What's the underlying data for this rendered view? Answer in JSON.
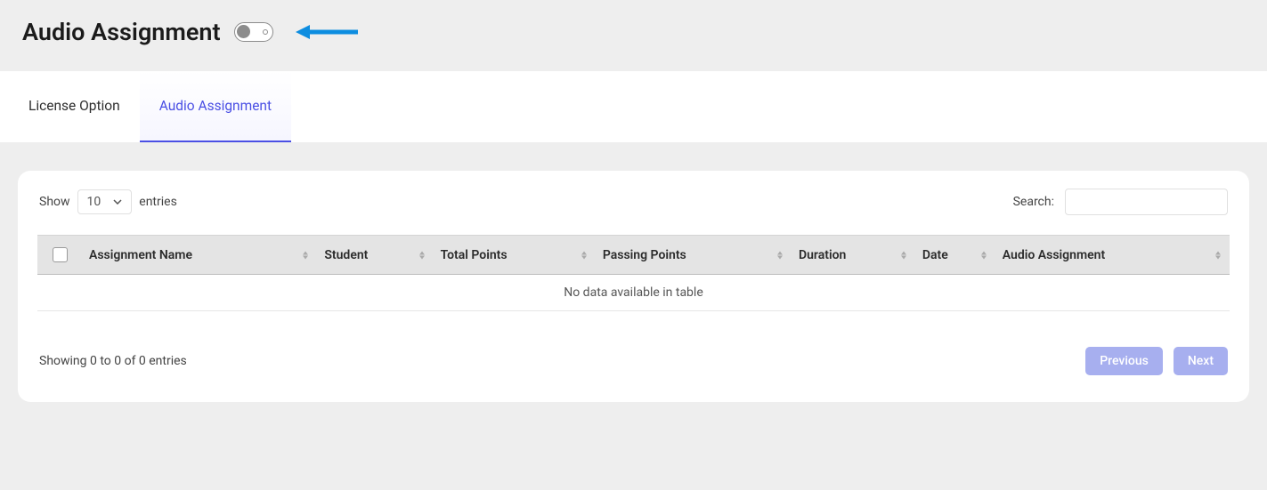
{
  "header": {
    "title": "Audio Assignment"
  },
  "tabs": [
    {
      "label": "License Option",
      "active": false
    },
    {
      "label": "Audio Assignment",
      "active": true
    }
  ],
  "controls": {
    "show_label": "Show",
    "entries_value": "10",
    "entries_label": "entries",
    "search_label": "Search:",
    "search_value": ""
  },
  "table": {
    "columns": [
      "Assignment Name",
      "Student",
      "Total Points",
      "Passing Points",
      "Duration",
      "Date",
      "Audio Assignment"
    ],
    "empty_text": "No data available in table"
  },
  "footer": {
    "info": "Showing 0 to 0 of 0 entries",
    "prev_label": "Previous",
    "next_label": "Next"
  }
}
